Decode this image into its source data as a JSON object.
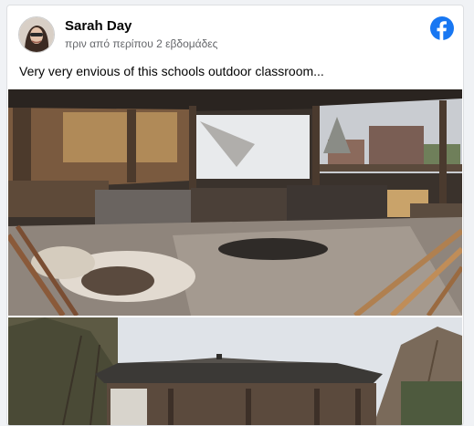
{
  "post": {
    "author": "Sarah Day",
    "timestamp": "πριν από περίπου 2 εβδομάδες",
    "text": "Very very envious of this schools outdoor classroom...",
    "platform_icon": "facebook-icon",
    "avatar_icon": "user-avatar"
  },
  "colors": {
    "facebook_blue": "#1877f2",
    "author_text": "#050505",
    "secondary_text": "#65676b"
  },
  "images": [
    {
      "name": "outdoor-classroom-interior-photo"
    },
    {
      "name": "outdoor-classroom-exterior-photo"
    }
  ]
}
